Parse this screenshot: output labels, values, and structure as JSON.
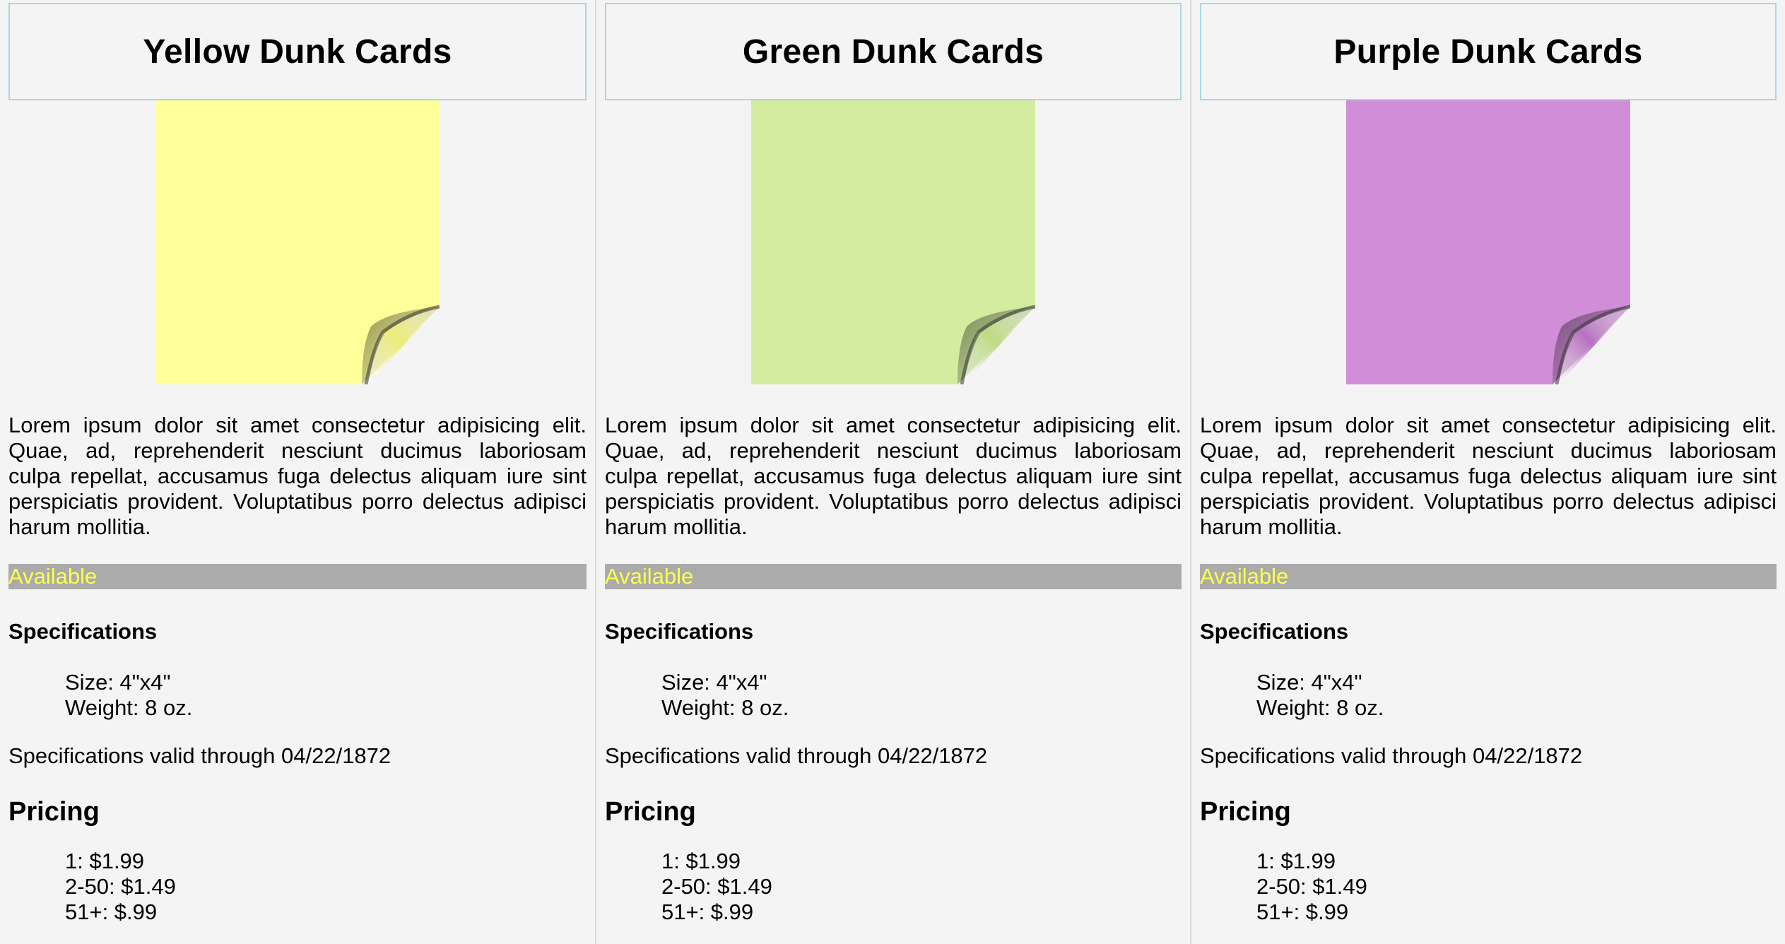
{
  "cards": [
    {
      "title": "Yellow Dunk Cards",
      "note_color": "#ffff99",
      "fold_color": "#ecec7a",
      "description": "Lorem ipsum dolor sit amet consectetur adipisicing elit. Quae, ad, reprehenderit nesciunt ducimus laboriosam culpa repellat, accusamus fuga delectus aliquam iure sint perspiciatis provident. Voluptatibus porro delectus adipisci harum mollitia.",
      "availability": "Available",
      "specs_heading": "Specifications",
      "size": "Size: 4\"x4\"",
      "weight": "Weight: 8 oz.",
      "valid": "Specifications valid through 04/22/1872",
      "pricing_heading": "Pricing",
      "prices": [
        "1: $1.99",
        "2-50: $1.49",
        "51+: $.99"
      ]
    },
    {
      "title": "Green Dunk Cards",
      "note_color": "#d3eca0",
      "fold_color": "#bedb84",
      "description": "Lorem ipsum dolor sit amet consectetur adipisicing elit. Quae, ad, reprehenderit nesciunt ducimus laboriosam culpa repellat, accusamus fuga delectus aliquam iure sint perspiciatis provident. Voluptatibus porro delectus adipisci harum mollitia.",
      "availability": "Available",
      "specs_heading": "Specifications",
      "size": "Size: 4\"x4\"",
      "weight": "Weight: 8 oz.",
      "valid": "Specifications valid through 04/22/1872",
      "pricing_heading": "Pricing",
      "prices": [
        "1: $1.99",
        "2-50: $1.49",
        "51+: $.99"
      ]
    },
    {
      "title": "Purple Dunk Cards",
      "note_color": "#d08ed8",
      "fold_color": "#b870c2",
      "description": "Lorem ipsum dolor sit amet consectetur adipisicing elit. Quae, ad, reprehenderit nesciunt ducimus laboriosam culpa repellat, accusamus fuga delectus aliquam iure sint perspiciatis provident. Voluptatibus porro delectus adipisci harum mollitia.",
      "availability": "Available",
      "specs_heading": "Specifications",
      "size": "Size: 4\"x4\"",
      "weight": "Weight: 8 oz.",
      "valid": "Specifications valid through 04/22/1872",
      "pricing_heading": "Pricing",
      "prices": [
        "1: $1.99",
        "2-50: $1.49",
        "51+: $.99"
      ]
    }
  ],
  "colors": {
    "background": "#f4f4f4",
    "header_border": "#a9d6e3",
    "availability_bar": "#ababab",
    "availability_text": "#ffff4a"
  },
  "icons": [
    "sticky-note-icon"
  ]
}
